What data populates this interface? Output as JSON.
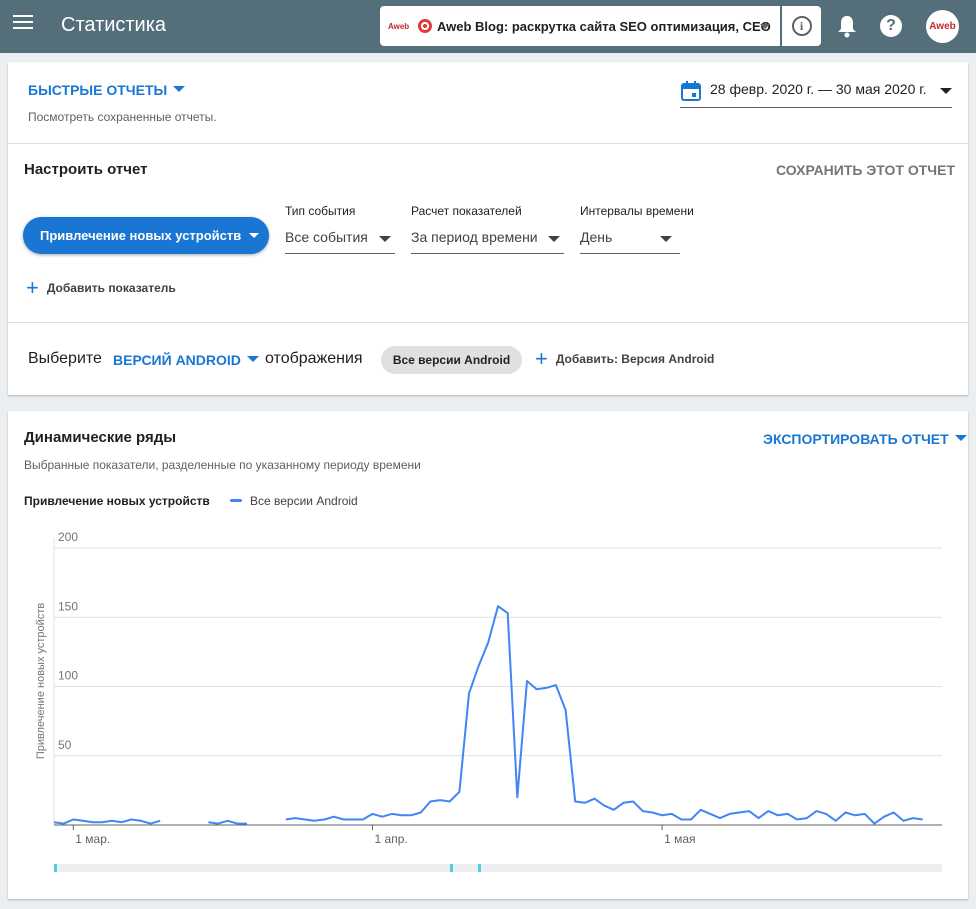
{
  "appbar": {
    "title": "Статистика",
    "project_logo": "Aweb",
    "project_name": "Aweb Blog: раскрутка сайта SEO оптимизация, CEO",
    "avatar_text": "Aweb",
    "icons": [
      "menu-icon",
      "target-icon",
      "info-icon",
      "bell-icon",
      "help-icon"
    ]
  },
  "quick_reports": {
    "label": "БЫСТРЫЕ ОТЧЕТЫ",
    "hint": "Посмотреть сохраненные отчеты.",
    "date_range": "28 февр. 2020 г. — 30 мая 2020 г."
  },
  "configure": {
    "title": "Настроить отчет",
    "save_label": "СОХРАНИТЬ ЭТОТ ОТЧЕТ",
    "metric_button": "Привлечение новых устройств",
    "event_type_label": "Тип события",
    "event_type_value": "Все события",
    "calc_label": "Расчет показателей",
    "calc_value": "За период времени",
    "interval_label": "Интервалы времени",
    "interval_value": "День",
    "add_metric": "Добавить показатель"
  },
  "display": {
    "choose": "Выберите",
    "dimension": "ВЕРСИЙ ANDROID",
    "display_word": "отображения",
    "chip": "Все версии Android",
    "add_dimension": "Добавить: Версия Android"
  },
  "timeseries": {
    "title": "Динамические ряды",
    "export_label": "ЭКСПОРТИРОВАТЬ ОТЧЕТ",
    "subtitle": "Выбранные показатели, разделенные по указанному периоду времени",
    "metric_name": "Привлечение новых устройств",
    "legend_series": "Все версии Android"
  },
  "colors": {
    "appbar": "#546e7a",
    "accent": "#1976d2",
    "series": "#4285f4",
    "range_bar": "#eceff1",
    "range_marker": "#4dd0e1"
  },
  "chart_data": {
    "type": "line",
    "ylabel": "Привлечение новых устройств",
    "xlabel": "",
    "ylim": [
      0,
      200
    ],
    "yticks": [
      50,
      100,
      150,
      200
    ],
    "x_tick_labels": [
      {
        "label": "1 мар.",
        "index": 2
      },
      {
        "label": "1 апр.",
        "index": 33
      },
      {
        "label": "1 мая",
        "index": 63
      }
    ],
    "grid": true,
    "x": [
      "2020-02-28",
      "2020-02-29",
      "2020-03-01",
      "2020-03-02",
      "2020-03-03",
      "2020-03-04",
      "2020-03-05",
      "2020-03-06",
      "2020-03-07",
      "2020-03-08",
      "2020-03-09",
      "2020-03-10",
      "2020-03-11",
      "2020-03-12",
      "2020-03-13",
      "2020-03-14",
      "2020-03-15",
      "2020-03-16",
      "2020-03-17",
      "2020-03-18",
      "2020-03-19",
      "2020-03-20",
      "2020-03-21",
      "2020-03-22",
      "2020-03-23",
      "2020-03-24",
      "2020-03-25",
      "2020-03-26",
      "2020-03-27",
      "2020-03-28",
      "2020-03-29",
      "2020-03-30",
      "2020-03-31",
      "2020-04-01",
      "2020-04-02",
      "2020-04-03",
      "2020-04-04",
      "2020-04-05",
      "2020-04-06",
      "2020-04-07",
      "2020-04-08",
      "2020-04-09",
      "2020-04-10",
      "2020-04-11",
      "2020-04-12",
      "2020-04-13",
      "2020-04-14",
      "2020-04-15",
      "2020-04-16",
      "2020-04-17",
      "2020-04-18",
      "2020-04-19",
      "2020-04-20",
      "2020-04-21",
      "2020-04-22",
      "2020-04-23",
      "2020-04-24",
      "2020-04-25",
      "2020-04-26",
      "2020-04-27",
      "2020-04-28",
      "2020-04-29",
      "2020-04-30",
      "2020-05-01",
      "2020-05-02",
      "2020-05-03",
      "2020-05-04",
      "2020-05-05",
      "2020-05-06",
      "2020-05-07",
      "2020-05-08",
      "2020-05-09",
      "2020-05-10",
      "2020-05-11",
      "2020-05-12",
      "2020-05-13",
      "2020-05-14",
      "2020-05-15",
      "2020-05-16",
      "2020-05-17",
      "2020-05-18",
      "2020-05-19",
      "2020-05-20",
      "2020-05-21",
      "2020-05-22",
      "2020-05-23",
      "2020-05-24",
      "2020-05-25",
      "2020-05-26",
      "2020-05-27",
      "2020-05-28",
      "2020-05-29",
      "2020-05-30"
    ],
    "series": [
      {
        "name": "Все версии Android",
        "values": [
          2,
          1,
          4,
          3,
          2,
          2,
          3,
          2,
          4,
          3,
          1,
          3,
          null,
          null,
          null,
          null,
          2,
          1,
          3,
          1,
          1,
          null,
          null,
          null,
          4,
          5,
          4,
          3,
          4,
          6,
          4,
          4,
          4,
          8,
          6,
          8,
          7,
          7,
          9,
          17,
          18,
          17,
          24,
          95,
          115,
          132,
          158,
          153,
          20,
          104,
          98,
          99,
          101,
          83,
          17,
          16,
          19,
          14,
          11,
          16,
          17,
          10,
          9,
          7,
          8,
          4,
          4,
          11,
          8,
          5,
          8,
          9,
          10,
          5,
          10,
          7,
          8,
          4,
          5,
          10,
          8,
          3,
          9,
          7,
          8,
          1,
          6,
          9,
          3,
          5,
          4,
          null,
          null
        ],
        "color": "#4285f4"
      }
    ]
  }
}
